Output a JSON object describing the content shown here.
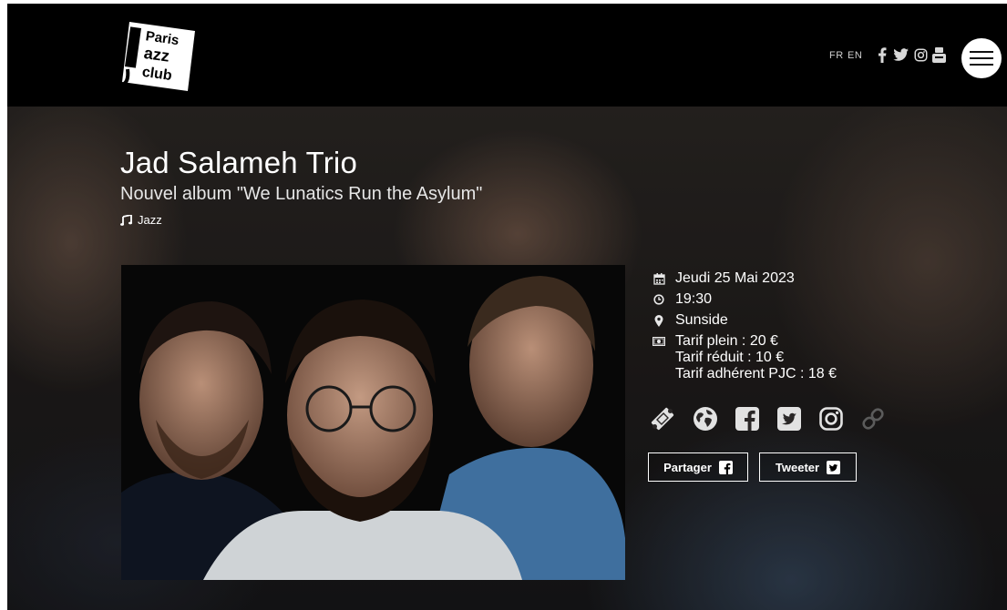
{
  "header": {
    "logo_alt": "Paris Jazz Club",
    "lang": {
      "fr": "FR",
      "en": "EN"
    },
    "social": [
      "facebook-icon",
      "twitter-icon",
      "instagram-icon",
      "youtube-icon"
    ],
    "menu_icon": "hamburger-icon"
  },
  "event": {
    "title": "Jad Salameh Trio",
    "subtitle": "Nouvel album \"We Lunatics Run the Asylum\"",
    "genre": "Jazz",
    "date": "Jeudi 25 Mai 2023",
    "time": "19:30",
    "venue": "Sunside",
    "prices": [
      "Tarif plein : 20 €",
      "Tarif réduit : 10 €",
      "Tarif adhérent PJC : 18 €"
    ]
  },
  "links": [
    "ticket-icon",
    "globe-icon",
    "facebook-icon",
    "twitter-icon",
    "instagram-icon",
    "link-icon"
  ],
  "share": {
    "facebook_label": "Partager",
    "twitter_label": "Tweeter"
  },
  "colors": {
    "background": "#000000",
    "text": "#ffffff",
    "muted": "#cfcfcf"
  }
}
